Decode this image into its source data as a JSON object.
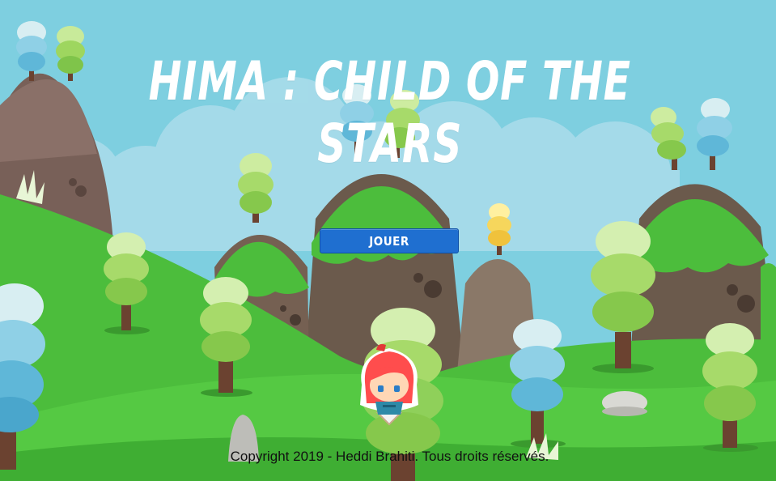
{
  "game": {
    "title": "HIMA : CHILD OF THE STARS",
    "play_button_label": "JOUER",
    "copyright": "Copyright 2019 - Heddi Brahiti. Tous droits réservés."
  },
  "colors": {
    "sky": "#7ecfe0",
    "grass": "#4cbd3c",
    "button": "#1f6fd0"
  }
}
